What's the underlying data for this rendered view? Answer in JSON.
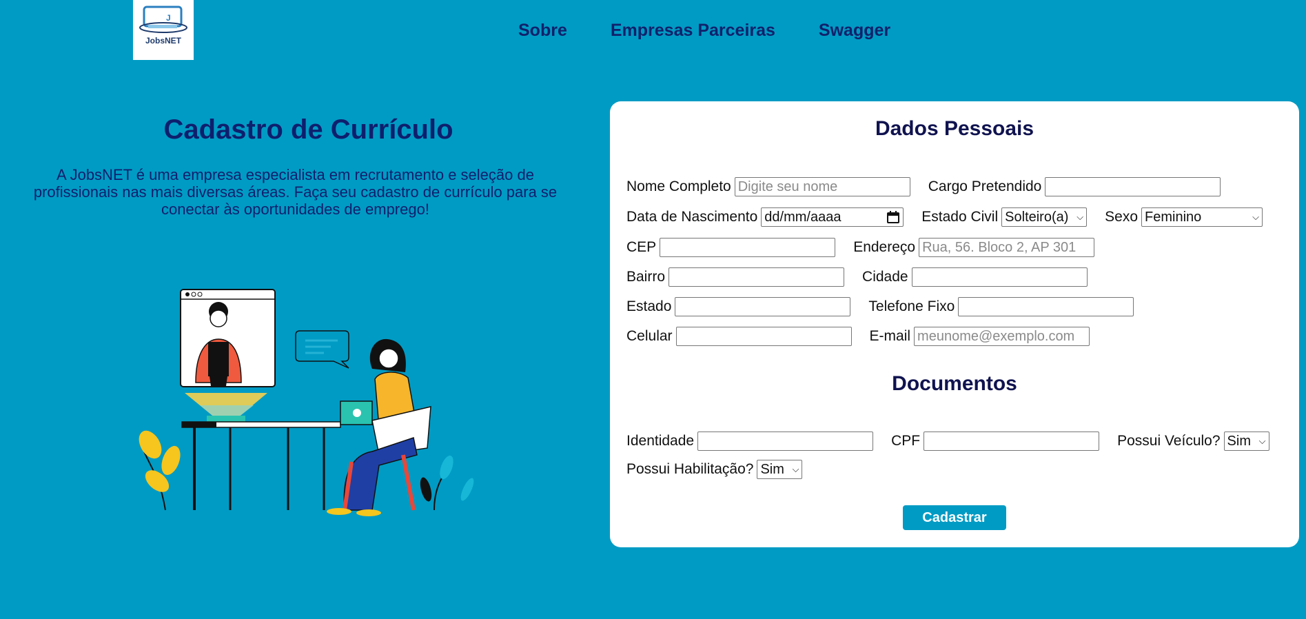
{
  "logo": {
    "text": "JobsNET"
  },
  "nav": {
    "items": [
      "Sobre",
      "Empresas Parceiras",
      "Swagger"
    ]
  },
  "hero": {
    "title": "Cadastro de Currículo",
    "description": "A JobsNET é uma empresa especialista em recrutamento e seleção de profissionais nas mais diversas áreas. Faça seu cadastro de currículo para se conectar às oportunidades de emprego!"
  },
  "form": {
    "personal_title": "Dados Pessoais",
    "documents_title": "Documentos",
    "labels": {
      "nome": "Nome Completo",
      "cargo": "Cargo Pretendido",
      "nascimento": "Data de Nascimento",
      "estado_civil": "Estado Civil",
      "sexo": "Sexo",
      "cep": "CEP",
      "endereco": "Endereço",
      "bairro": "Bairro",
      "cidade": "Cidade",
      "estado": "Estado",
      "telefone": "Telefone Fixo",
      "celular": "Celular",
      "email": "E-mail",
      "identidade": "Identidade",
      "cpf": "CPF",
      "veiculo": "Possui Veículo?",
      "habilitacao": "Possui Habilitação?"
    },
    "placeholders": {
      "nome": "Digite seu nome",
      "endereco": "Rua, 56. Bloco 2, AP 301",
      "email": "meunome@exemplo.com"
    },
    "values": {
      "nascimento": "dd/mm/aaaa",
      "estado_civil": "Solteiro(a)",
      "sexo": "Feminino",
      "veiculo": "Sim",
      "habilitacao": "Sim"
    },
    "submit_label": "Cadastrar"
  },
  "colors": {
    "background": "#009bc4",
    "heading": "#10216b",
    "button": "#009bc4"
  },
  "icons": {
    "date": "calendar-icon",
    "select": "chevron-down-icon"
  }
}
